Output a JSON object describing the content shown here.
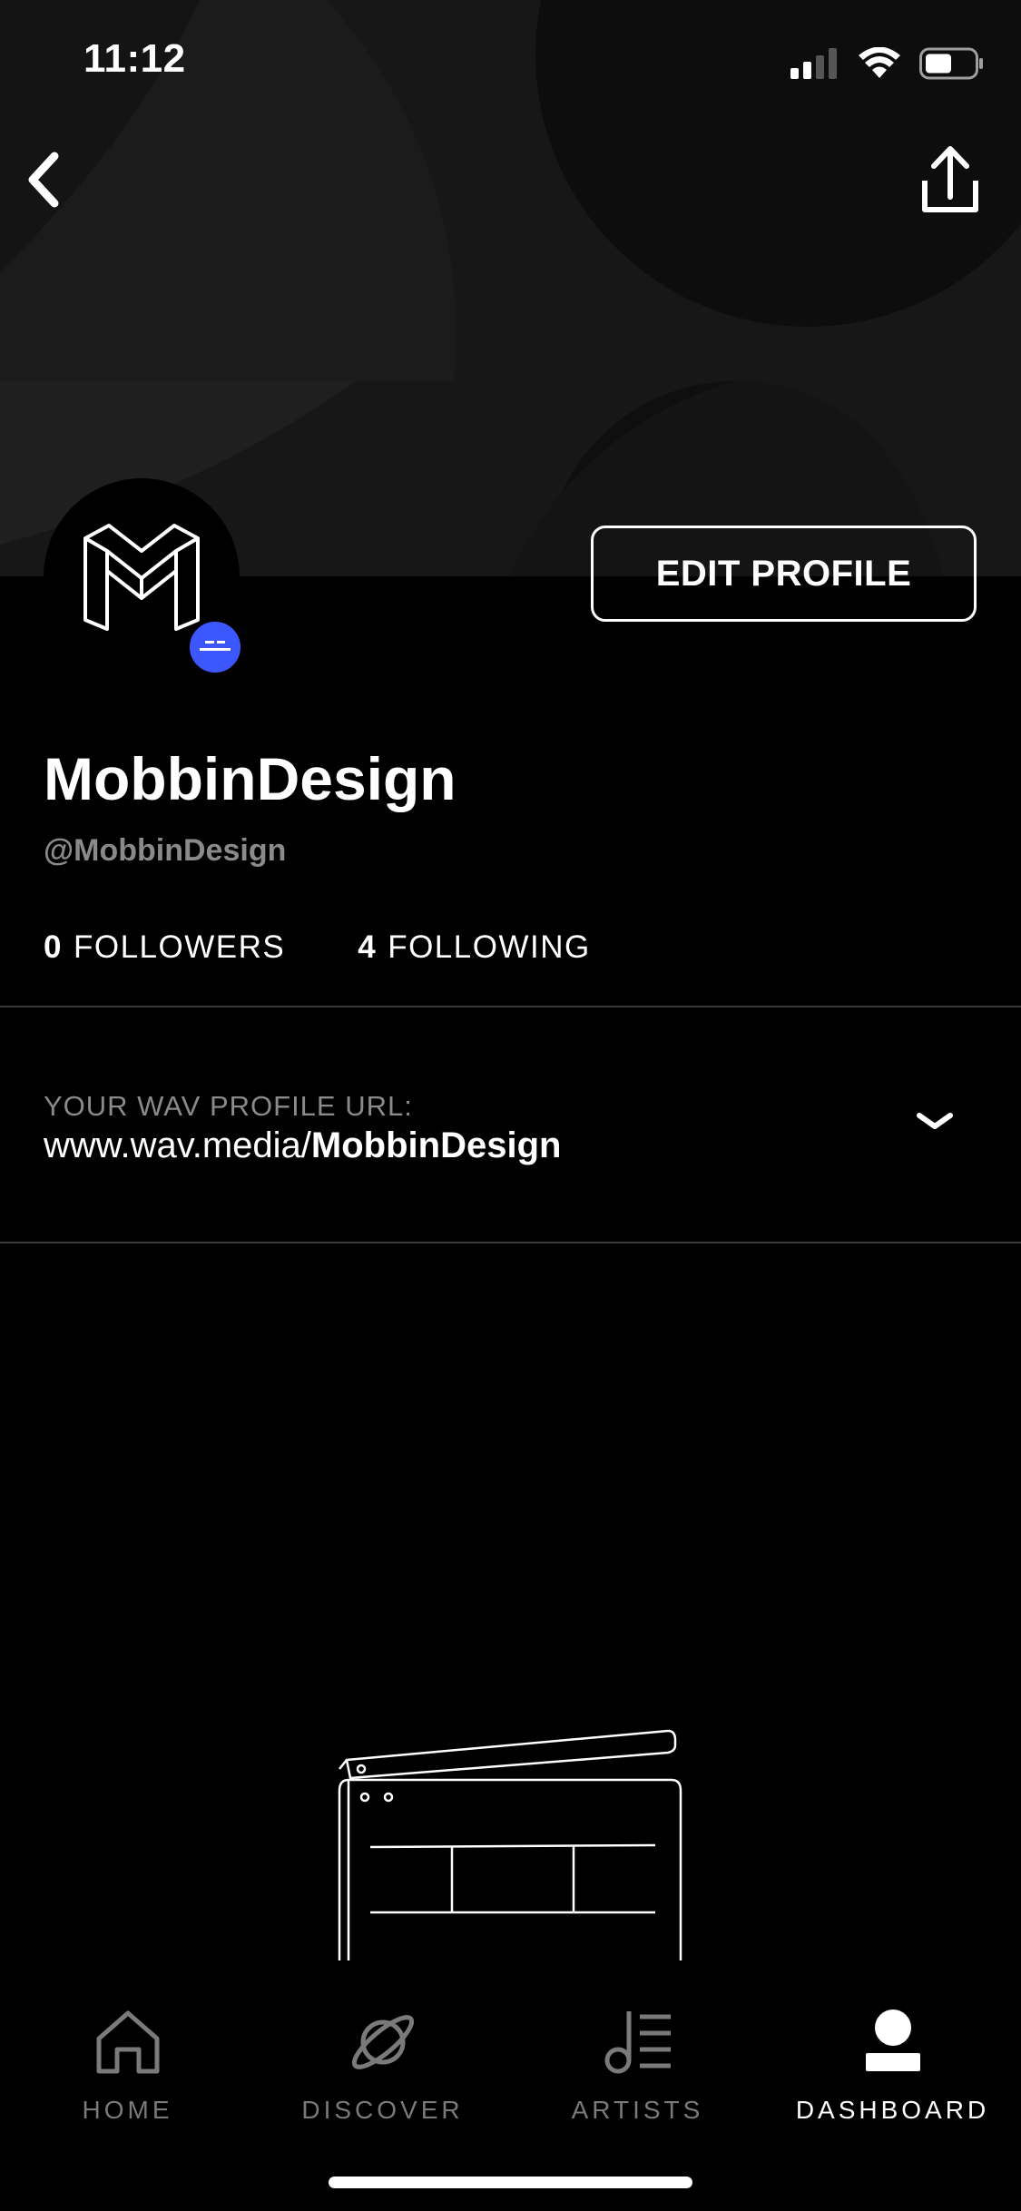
{
  "status_bar": {
    "time": "11:12"
  },
  "profile": {
    "name": "MobbinDesign",
    "handle": "@MobbinDesign",
    "edit_button_label": "EDIT PROFILE",
    "followers_count": "0",
    "followers_label": "FOLLOWERS",
    "following_count": "4",
    "following_label": "FOLLOWING"
  },
  "profile_url": {
    "label": "YOUR WAV PROFILE URL:",
    "prefix": "www.wav.media/",
    "username": "MobbinDesign"
  },
  "tabs": [
    {
      "label": "HOME",
      "icon": "home-icon",
      "active": false
    },
    {
      "label": "DISCOVER",
      "icon": "planet-icon",
      "active": false
    },
    {
      "label": "ARTISTS",
      "icon": "music-note-list-icon",
      "active": false
    },
    {
      "label": "DASHBOARD",
      "icon": "user-icon",
      "active": true
    }
  ],
  "colors": {
    "accent": "#3d57ff",
    "background": "#000000"
  }
}
